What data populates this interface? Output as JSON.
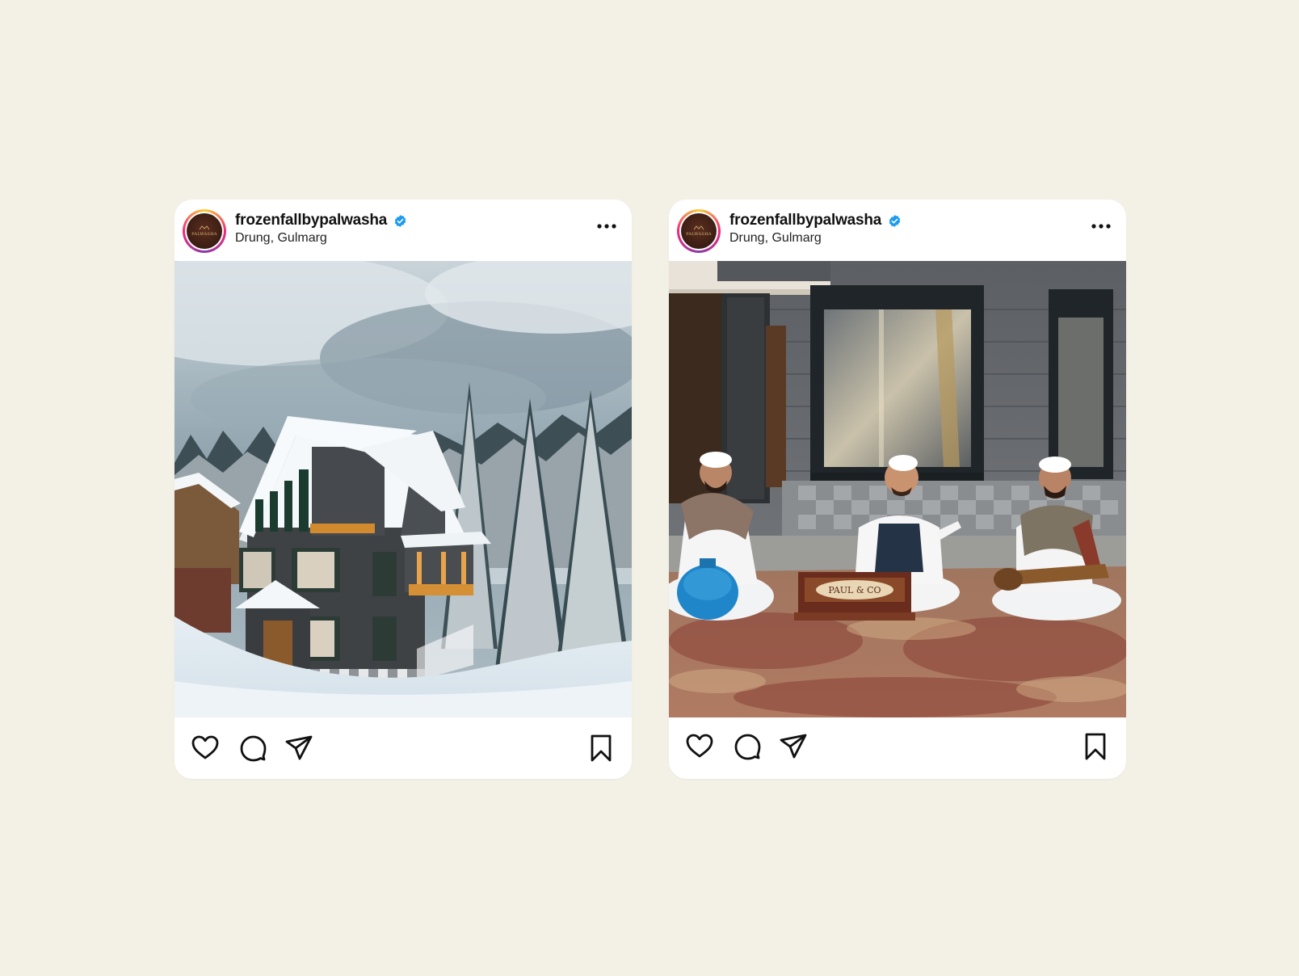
{
  "posts": [
    {
      "username": "frozenfallbypalwasha",
      "location": "Drung, Gulmarg",
      "avatar_text": "PALWASHA",
      "photo_alt": "photo",
      "icons": [
        "verified-badge-icon",
        "more-options-icon",
        "heart-icon",
        "comment-icon",
        "share-icon",
        "bookmark-icon"
      ]
    },
    {
      "username": "frozenfallbypalwasha",
      "location": "Drung, Gulmarg",
      "avatar_text": "PALWASHA",
      "photo_alt": "photo",
      "harmonium_label": "PAUL & CO",
      "icons": [
        "verified-badge-icon",
        "more-options-icon",
        "heart-icon",
        "comment-icon",
        "share-icon",
        "bookmark-icon"
      ]
    }
  ],
  "colors": {
    "background": "#f3f1e6",
    "card": "#ffffff",
    "verified": "#1d9bf0",
    "text": "#111111"
  }
}
